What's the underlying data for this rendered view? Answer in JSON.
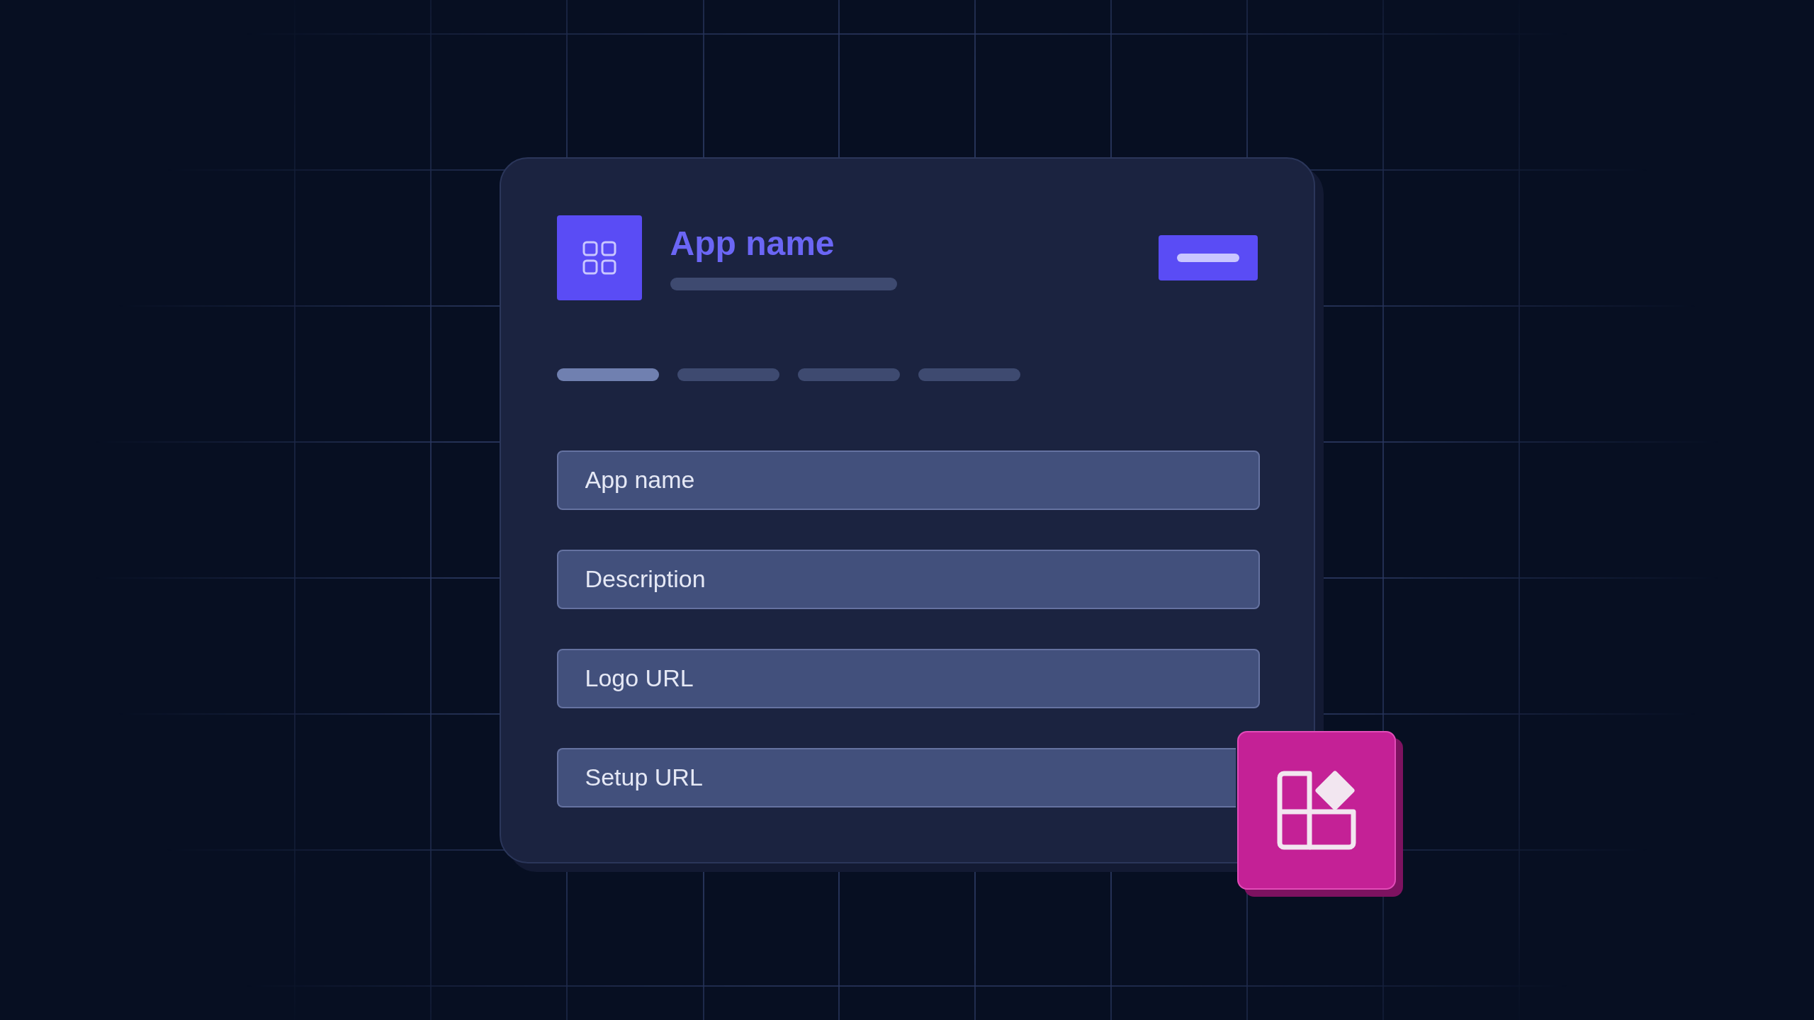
{
  "header": {
    "title": "App name"
  },
  "tabs": [
    {
      "selected": true
    },
    {
      "selected": false
    },
    {
      "selected": false
    },
    {
      "selected": false
    }
  ],
  "fields": [
    {
      "placeholder": "App name"
    },
    {
      "placeholder": "Description"
    },
    {
      "placeholder": "Logo URL"
    },
    {
      "placeholder": "Setup URL"
    }
  ]
}
